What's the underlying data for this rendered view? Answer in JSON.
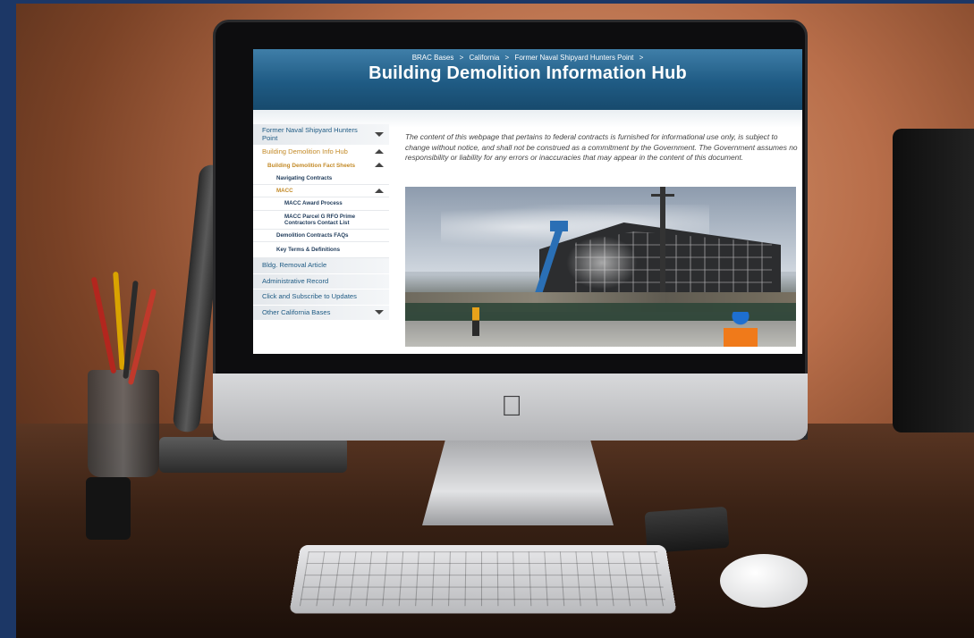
{
  "breadcrumb": {
    "items": [
      "BRAC Bases",
      "California",
      "Former Naval Shipyard Hunters Point"
    ],
    "separator": ">"
  },
  "page": {
    "title": "Building Demolition Information Hub",
    "disclaimer": "The content of this webpage that pertains to federal contracts is furnished for informational use only, is subject to change without notice, and shall not be construed as a commitment by the Government. The Government assumes no responsibility or liability for any errors or inaccuracies that may appear in the content of this document."
  },
  "sidebar": {
    "items": [
      {
        "label": "Former Naval Shipyard Hunters Point",
        "arrow": "chevron-down-icon"
      },
      {
        "label": "Building Demolition Info Hub",
        "arrow": "chevron-up-icon"
      },
      {
        "label": "Building Demolition Fact Sheets",
        "arrow": "chevron-up-icon"
      },
      {
        "label": "Navigating Contracts"
      },
      {
        "label": "MACC",
        "arrow": "chevron-up-icon"
      },
      {
        "label": "MACC Award Process"
      },
      {
        "label": "MACC Parcel G RFO Prime Contractors Contact List"
      },
      {
        "label": "Demolition Contracts FAQs"
      },
      {
        "label": "Key Terms & Definitions"
      },
      {
        "label": "Bldg. Removal Article"
      },
      {
        "label": "Administrative Record"
      },
      {
        "label": "Click and Subscribe to Updates"
      },
      {
        "label": "Other California Bases",
        "arrow": "chevron-down-icon"
      }
    ]
  },
  "colors": {
    "hero": "#1f5b84",
    "nav_active": "#c38a27",
    "nav_text": "#1f5b84",
    "frame_bg": "#1c3766"
  }
}
